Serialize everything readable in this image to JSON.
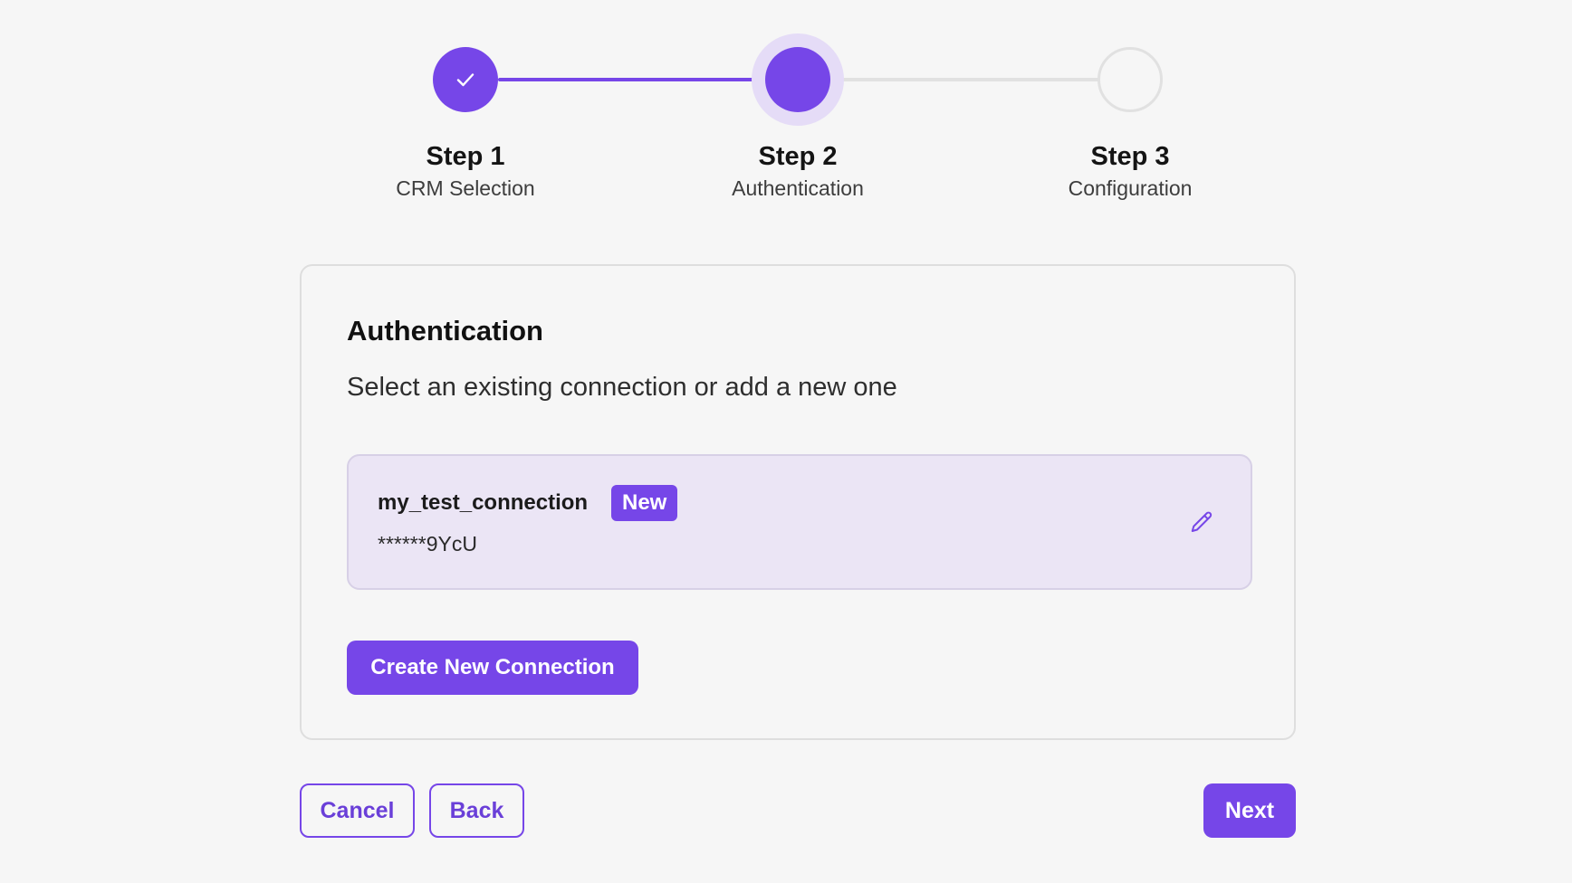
{
  "stepper": {
    "steps": [
      {
        "title": "Step 1",
        "subtitle": "CRM Selection",
        "state": "completed",
        "icon": "check-icon"
      },
      {
        "title": "Step 2",
        "subtitle": "Authentication",
        "state": "active"
      },
      {
        "title": "Step 3",
        "subtitle": "Configuration",
        "state": "pending"
      }
    ]
  },
  "card": {
    "title": "Authentication",
    "subtitle": "Select an existing connection or add a new one",
    "connections": [
      {
        "name": "my_test_connection",
        "badge": "New",
        "masked_key": "******9YcU",
        "edit_icon": "pencil-icon"
      }
    ],
    "create_label": "Create New Connection"
  },
  "footer": {
    "cancel_label": "Cancel",
    "back_label": "Back",
    "next_label": "Next"
  },
  "colors": {
    "accent": "#7646e8",
    "accent_light": "#ebe5f5",
    "background": "#f6f6f6",
    "border": "#dedede"
  }
}
